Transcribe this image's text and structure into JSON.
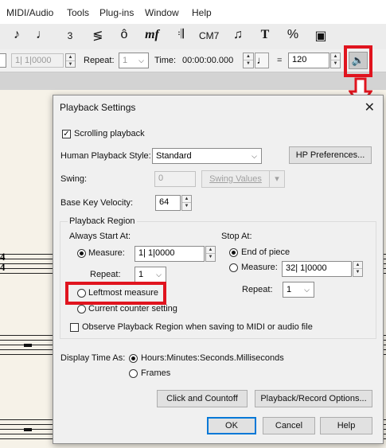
{
  "menu": {
    "items": [
      "MIDI/Audio",
      "Tools",
      "Plug-ins",
      "Window",
      "Help"
    ]
  },
  "toolbar": {
    "icons": [
      "eighth-note-icon",
      "mic-icon",
      "tuplet-icon",
      "hairpin-icon",
      "articulation-icon",
      "dynamics-icon",
      "repeat-icon",
      "chord-icon",
      "expression-icon",
      "text-icon",
      "percent-icon",
      "page-icon"
    ],
    "chord_label": "CM7",
    "text_label": "T",
    "percent_label": "%",
    "dynamics_label": "mf",
    "tuplet_label": "3"
  },
  "playbar": {
    "counter_value": "1| 1|0000",
    "repeat_label": "Repeat:",
    "repeat_value": "1",
    "time_label": "Time:",
    "time_value": "00:00:00.000",
    "equals_label": "=",
    "tempo_value": "120"
  },
  "dialog": {
    "title": "Playback Settings",
    "scrolling_playback_label": "Scrolling playback",
    "scrolling_playback_checked": true,
    "human_playback_label": "Human Playback Style:",
    "human_playback_value": "Standard",
    "hp_preferences_label": "HP Preferences...",
    "swing_label": "Swing:",
    "swing_value": "0",
    "swing_values_label": "Swing Values",
    "base_key_velocity_label": "Base Key Velocity:",
    "base_key_velocity_value": "64",
    "playback_region_label": "Playback Region",
    "always_start_at_label": "Always Start At:",
    "start_measure_label": "Measure:",
    "start_measure_value": "1| 1|0000",
    "start_repeat_label": "Repeat:",
    "start_repeat_value": "1",
    "leftmost_measure_label": "Leftmost measure",
    "current_counter_label": "Current counter setting",
    "stop_at_label": "Stop At:",
    "end_of_piece_label": "End of piece",
    "stop_measure_label": "Measure:",
    "stop_measure_value": "32| 1|0000",
    "stop_repeat_label": "Repeat:",
    "stop_repeat_value": "1",
    "observe_region_label": "Observe Playback Region when saving to MIDI or audio file",
    "display_time_as_label": "Display Time As:",
    "time_format_hms_label": "Hours:Minutes:Seconds.Milliseconds",
    "time_format_frames_label": "Frames",
    "click_countoff_label": "Click and Countoff",
    "playback_record_options_label": "Playback/Record Options...",
    "ok_label": "OK",
    "cancel_label": "Cancel",
    "help_label": "Help"
  },
  "score": {
    "time_signature_top": "4",
    "time_signature_bottom": "4"
  },
  "colors": {
    "highlight": "#e0141e",
    "default_button_border": "#0078d7"
  }
}
